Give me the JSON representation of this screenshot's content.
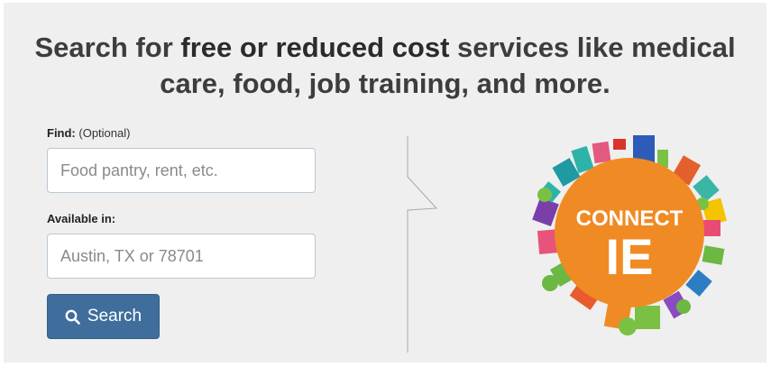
{
  "headline": {
    "prefix": "Search for ",
    "bold": "free or reduced cost",
    "suffix": " services like medical care, food, job training, and more."
  },
  "find": {
    "label": "Find:",
    "optional": "(Optional)",
    "placeholder": "Food pantry, rent, etc."
  },
  "location": {
    "label": "Available in:",
    "placeholder": "Austin, TX or 78701"
  },
  "search_button": {
    "icon": "search-icon",
    "label": "Search"
  },
  "logo": {
    "line1": "CONNECT",
    "line2": "IE"
  },
  "colors": {
    "panel_bg": "#efefef",
    "button": "#3f6e9d",
    "logo_orange": "#f08a24"
  }
}
